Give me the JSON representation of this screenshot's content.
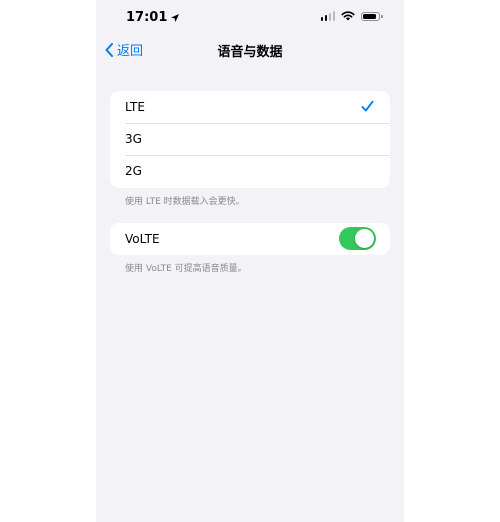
{
  "status_bar": {
    "time": "17:01",
    "icons": [
      "location-arrow-icon",
      "cellular-signal-icon",
      "wifi-icon",
      "battery-icon"
    ]
  },
  "nav": {
    "back_label": "返回",
    "title": "语音与数据"
  },
  "network_options": {
    "items": [
      {
        "label": "LTE",
        "selected": true
      },
      {
        "label": "3G",
        "selected": false
      },
      {
        "label": "2G",
        "selected": false
      }
    ],
    "footer": "使用 LTE 时数据载入会更快。"
  },
  "volte": {
    "label": "VoLTE",
    "enabled": true,
    "footer": "使用 VoLTE 可提高语音质量。"
  },
  "colors": {
    "accent": "#007aff",
    "toggle_on": "#34c759",
    "background": "#f2f2f7"
  }
}
